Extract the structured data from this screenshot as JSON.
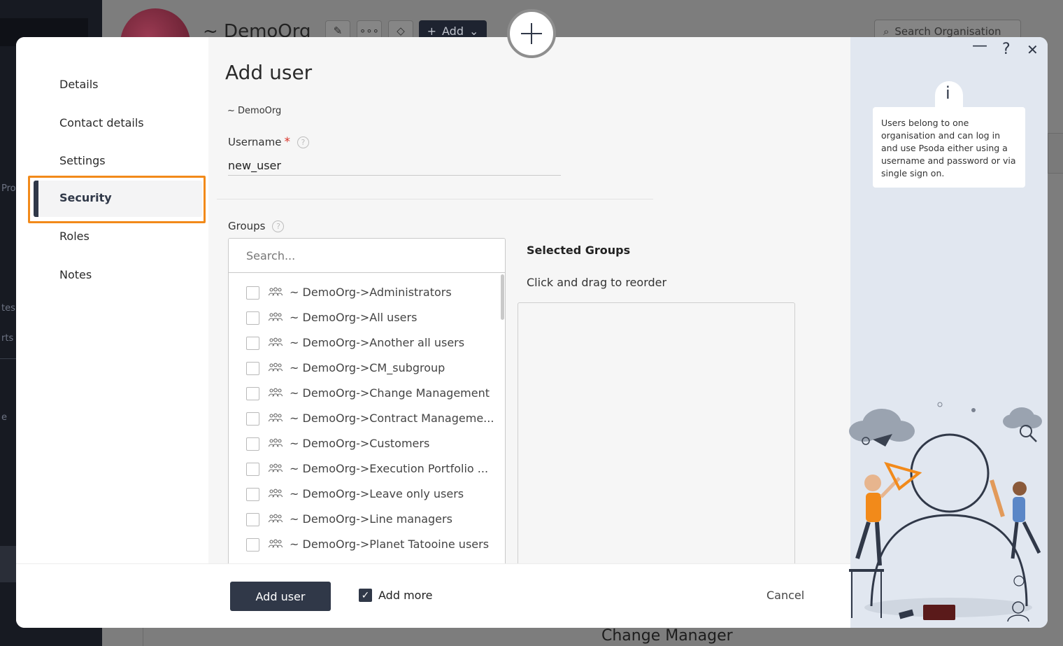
{
  "background": {
    "org_title": "~ DemoOrg",
    "add_button": "Add",
    "search_placeholder": "Search Organisation",
    "footer_text": "Change Manager",
    "left_fragments": [
      "Pro",
      "tes",
      "rts a",
      "e"
    ]
  },
  "nav": {
    "items": [
      {
        "label": "Details"
      },
      {
        "label": "Contact details"
      },
      {
        "label": "Settings"
      },
      {
        "label": "Security",
        "active": true
      },
      {
        "label": "Roles"
      },
      {
        "label": "Notes"
      }
    ]
  },
  "form": {
    "title": "Add user",
    "org": "~ DemoOrg",
    "username_label": "Username",
    "username_required": "*",
    "username_value": "new_user",
    "groups_label": "Groups",
    "groups_search_placeholder": "Search...",
    "groups": [
      "~ DemoOrg->Administrators",
      "~ DemoOrg->All users",
      "~ DemoOrg->Another all users",
      "~ DemoOrg->CM_subgroup",
      "~ DemoOrg->Change Management",
      "~ DemoOrg->Contract Manageme...",
      "~ DemoOrg->Customers",
      "~ DemoOrg->Execution Portfolio ...",
      "~ DemoOrg->Leave only users",
      "~ DemoOrg->Line managers",
      "~ DemoOrg->Planet Tatooine users"
    ],
    "selected_title": "Selected Groups",
    "selected_hint": "Click and drag to reorder"
  },
  "footer": {
    "add_user": "Add user",
    "add_more": "Add more",
    "add_more_checked": true,
    "cancel": "Cancel"
  },
  "help_panel": {
    "minimize": "—",
    "help": "?",
    "close": "✕",
    "info_icon": "i",
    "info_text": "Users belong to one organisation and can log in and use Psoda either using a username and password or via single sign on."
  },
  "colors": {
    "accent_dark": "#303848",
    "highlight": "#f28a1a",
    "required": "#d9352b",
    "illustration_orange": "#f28a1a"
  }
}
